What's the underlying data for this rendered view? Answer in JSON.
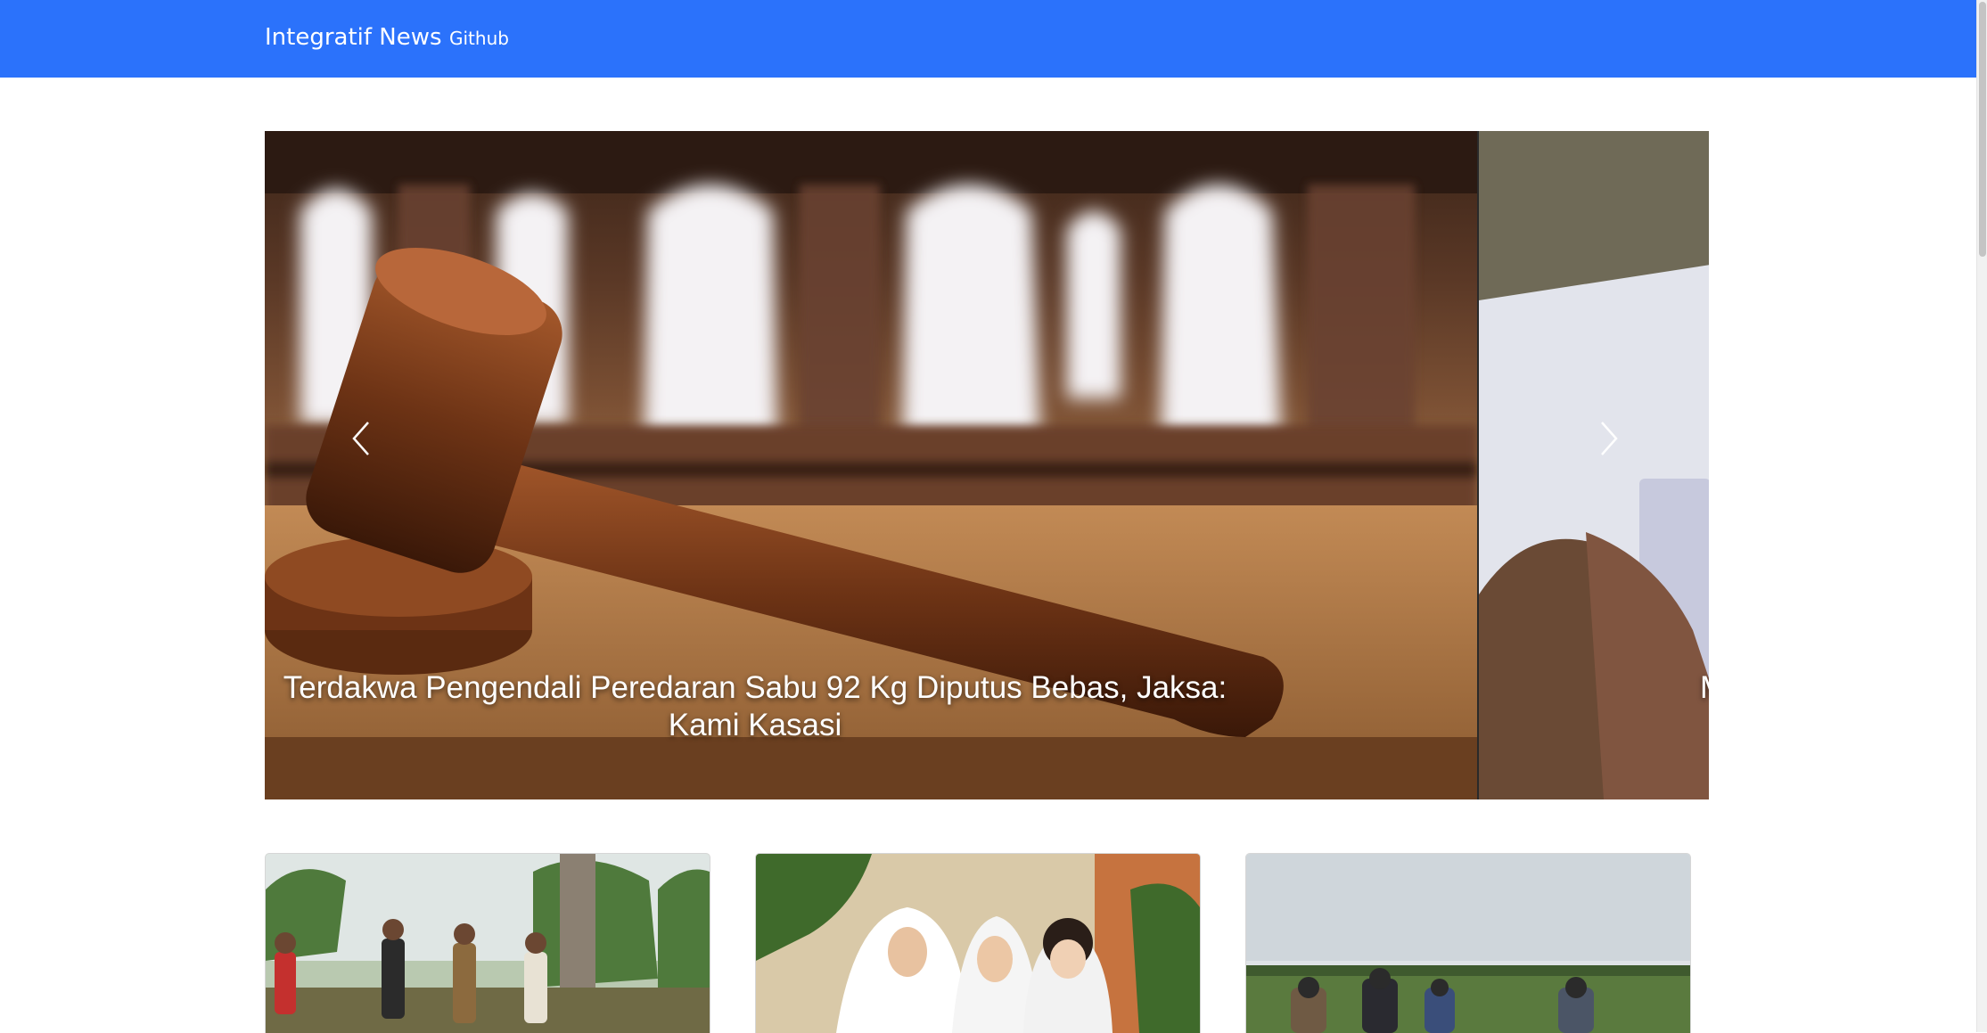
{
  "navbar": {
    "brand": "Integratif News",
    "links": [
      {
        "label": "Github"
      }
    ],
    "background_color": "#2b72fb"
  },
  "carousel": {
    "slides": [
      {
        "caption": "Terdakwa Pengendali Peredaran Sabu 92 Kg Diputus Bebas, Jaksa: Kami Kasasi",
        "image": "judge-gavel-photo"
      },
      {
        "caption": "M",
        "image": "hand-holding-package-photo"
      }
    ],
    "controls": {
      "prev_icon": "chevron-left-icon",
      "next_icon": "chevron-right-icon"
    }
  },
  "cards": [
    {
      "image": "villagers-coconut-trees-photo"
    },
    {
      "image": "students-reading-photo"
    },
    {
      "image": "officials-field-photo"
    }
  ]
}
